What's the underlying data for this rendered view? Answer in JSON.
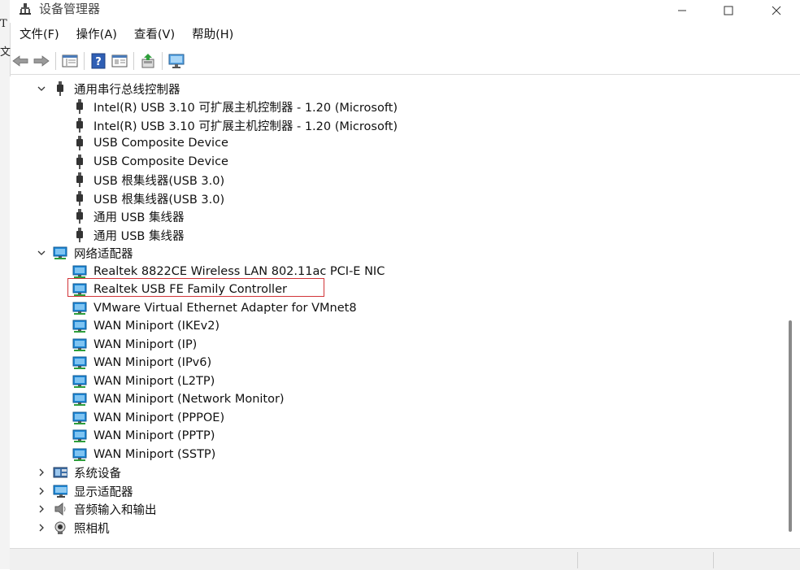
{
  "background_window": {
    "fragments": [
      "T",
      "文"
    ]
  },
  "window": {
    "title": "设备管理器",
    "controls": [
      "minimize",
      "maximize",
      "close"
    ]
  },
  "menu": [
    {
      "label": "文件(F)"
    },
    {
      "label": "操作(A)"
    },
    {
      "label": "查看(V)"
    },
    {
      "label": "帮助(H)"
    }
  ],
  "toolbar": {
    "buttons": [
      "back-arrow-icon",
      "forward-arrow-icon",
      "properties-panel-icon",
      "help-icon",
      "device-view-icon",
      "update-driver-icon",
      "scan-hardware-icon"
    ]
  },
  "tree": {
    "usb_controllers": {
      "label": "通用串行总线控制器",
      "expanded": true,
      "children": [
        "Intel(R) USB 3.10 可扩展主机控制器 - 1.20 (Microsoft)",
        "Intel(R) USB 3.10 可扩展主机控制器 - 1.20 (Microsoft)",
        "USB Composite Device",
        "USB Composite Device",
        "USB 根集线器(USB 3.0)",
        "USB 根集线器(USB 3.0)",
        "通用 USB 集线器",
        "通用 USB 集线器"
      ]
    },
    "network_adapters": {
      "label": "网络适配器",
      "expanded": true,
      "highlighted_child": "Realtek USB FE Family Controller",
      "children": [
        "Realtek 8822CE Wireless LAN 802.11ac PCI-E NIC",
        "Realtek USB FE Family Controller",
        "VMware Virtual Ethernet Adapter for VMnet8",
        "WAN Miniport (IKEv2)",
        "WAN Miniport (IP)",
        "WAN Miniport (IPv6)",
        "WAN Miniport (L2TP)",
        "WAN Miniport (Network Monitor)",
        "WAN Miniport (PPPOE)",
        "WAN Miniport (PPTP)",
        "WAN Miniport (SSTP)"
      ]
    },
    "collapsed_categories": [
      {
        "label": "系统设备",
        "icon": "system-devices-icon"
      },
      {
        "label": "显示适配器",
        "icon": "display-adapter-icon"
      },
      {
        "label": "音频输入和输出",
        "icon": "speaker-icon"
      },
      {
        "label": "照相机",
        "icon": "camera-icon"
      }
    ]
  },
  "colors": {
    "highlight_border": "#d13438",
    "network_icon": "#1e88d8",
    "usb_icon": "#3a3a3a"
  }
}
